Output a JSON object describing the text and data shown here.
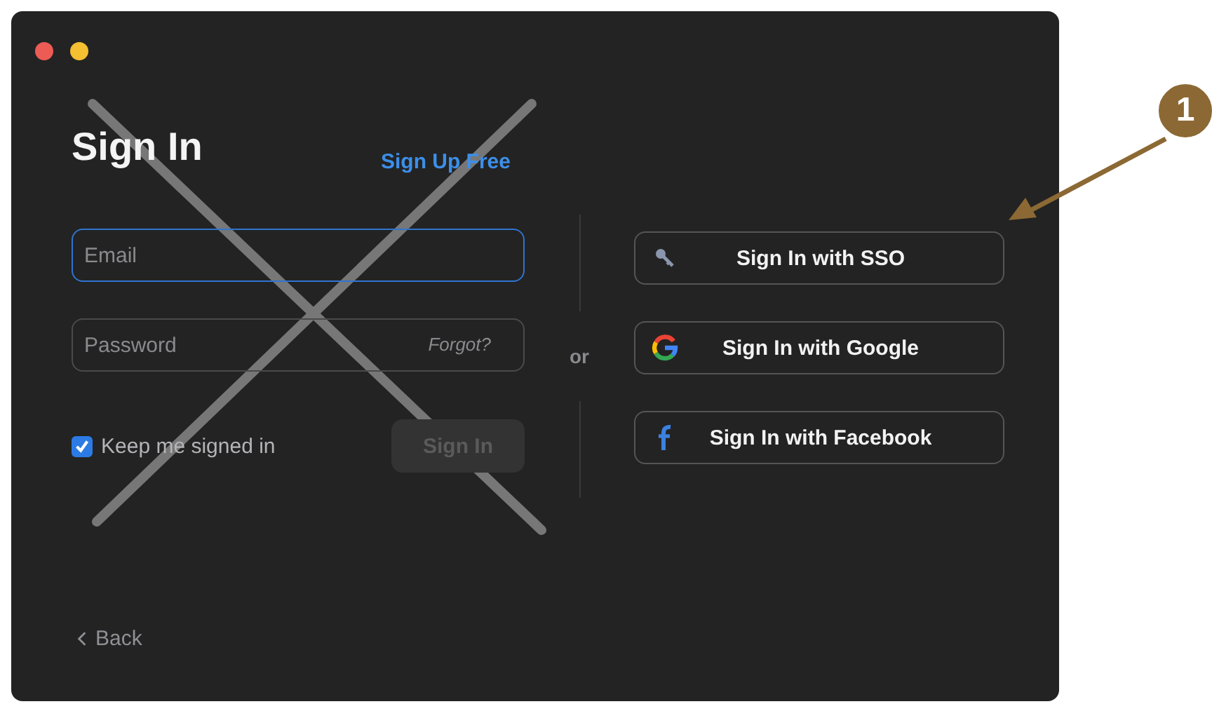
{
  "window": {
    "controls": [
      {
        "kind": "close"
      },
      {
        "kind": "minimize"
      }
    ]
  },
  "sign_in": {
    "title": "Sign In",
    "sign_up_link": "Sign Up Free",
    "fields": [
      {
        "placeholder": "Email",
        "focused": true
      },
      {
        "placeholder": "Password",
        "focused": false,
        "link": "Forgot?"
      }
    ],
    "keep_signed_in": {
      "label": "Keep me signed in",
      "checked": true
    },
    "submit": {
      "label": "Sign In",
      "disabled": true
    }
  },
  "separator": "or",
  "providers": [
    {
      "kind": "sso",
      "label": "Sign In with SSO"
    },
    {
      "kind": "google",
      "label": "Sign In with Google"
    },
    {
      "kind": "facebook",
      "label": "Sign In with Facebook"
    }
  ],
  "back": "Back",
  "annotation": {
    "label": "1"
  }
}
